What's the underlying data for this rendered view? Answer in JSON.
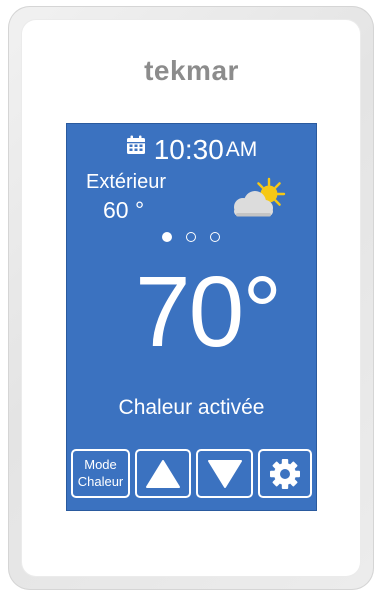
{
  "device": {
    "brand": "tekmar"
  },
  "screen": {
    "clock": {
      "time": "10:30",
      "ampm": "AM",
      "icon": "calendar-icon"
    },
    "outdoor": {
      "label": "Extérieur",
      "temp": "60 °"
    },
    "weather_icon": "partly-sunny-icon",
    "pages": {
      "count": 3,
      "active_index": 0
    },
    "main_temp": "70°",
    "status": "Chaleur activée",
    "buttons": {
      "mode_line1": "Mode",
      "mode_line2": "Chaleur",
      "up_icon": "arrow-up-icon",
      "down_icon": "arrow-down-icon",
      "settings_icon": "gear-icon"
    }
  },
  "colors": {
    "screen_background": "#3b72c0",
    "screen_text": "#ffffff",
    "brand_text": "#8c8c8c",
    "sun": "#f5c816",
    "cloud": "#dcdcdc"
  }
}
